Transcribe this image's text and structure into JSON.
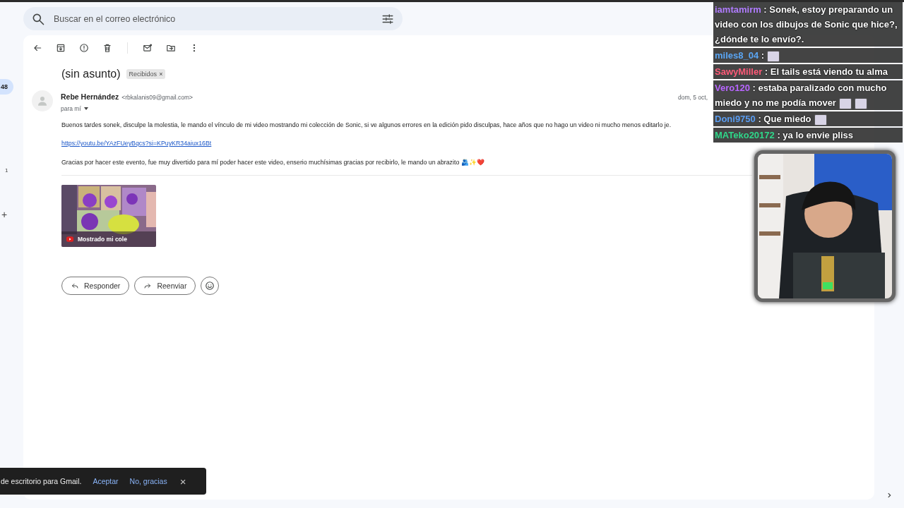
{
  "left_rail": {
    "badge": "48",
    "count": "1",
    "add": "+"
  },
  "search": {
    "placeholder": "Buscar en el correo electrónico"
  },
  "message": {
    "subject": "(sin asunto)",
    "label": {
      "text": "Recibidos",
      "remove": "×"
    },
    "sender": {
      "name": "Rebe Hernández",
      "email": "<rbkalanis09@gmail.com>",
      "to": "para mí"
    },
    "date": "dom, 5 oct,",
    "paragraphs": [
      {
        "kind": "text",
        "text": "Buenos tardes sonek, disculpe la molestia, le mando el vínculo de mi video mostrando mi colección de Sonic, si ve algunos errores en la edición pido disculpas, hace años que no hago un video ni mucho menos editarlo je."
      },
      {
        "kind": "link",
        "text": "https://youtu.be/YAzFUeyBqcs?si=KPuyKR34aiux16Bt"
      },
      {
        "kind": "text",
        "text": "Gracias por hacer este evento, fue muy divertido para mí poder hacer este video, enserio muchísimas gracias por recibirlo, le mando un abrazito 🫂✨❤️"
      }
    ],
    "attachment": {
      "kind": "picture",
      "caption": "Mostrado mi cole"
    },
    "actions": [
      "Responder",
      "Reenviar"
    ]
  },
  "toast": {
    "text": "de escritorio para Gmail.",
    "actions": [
      "Aceptar",
      "No, gracias"
    ],
    "close": "×"
  },
  "chat": [
    {
      "user": "iamtamirm",
      "color": "#b07cff",
      "text": ": Sonek, estoy preparando un video con los dibujos de Sonic que hice?, ¿dónde te lo envío?."
    },
    {
      "user": "miles8_04",
      "color": "#5aa6f5",
      "text": ":",
      "emotes": [
        {
          "kind": "emote"
        }
      ]
    },
    {
      "user": "SawyMiller",
      "color": "#ff5a78",
      "text": ": El tails está viendo tu alma"
    },
    {
      "user": "Vero120",
      "color": "#b866ff",
      "text": ": estaba paralizado con mucho miedo y no me podía mover",
      "emotes": [
        {
          "kind": "emote"
        },
        {
          "kind": "emote"
        }
      ]
    },
    {
      "user": "Doni9750",
      "color": "#5a9cf0",
      "text": ": Que miedo",
      "emotes": [
        {
          "kind": "emote"
        }
      ]
    },
    {
      "user": "MATeko20172",
      "color": "#2fd88a",
      "text": ": ya lo envie pliss"
    }
  ]
}
